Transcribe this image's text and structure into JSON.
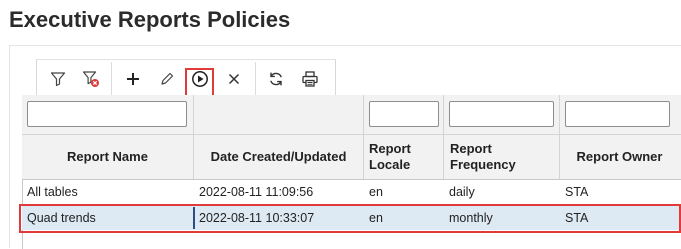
{
  "page": {
    "title": "Executive Reports Policies"
  },
  "toolbar": {
    "buttons": [
      {
        "name": "filter-icon"
      },
      {
        "name": "clear-filter-icon"
      },
      {
        "name": "add-icon"
      },
      {
        "name": "edit-icon"
      },
      {
        "name": "run-icon"
      },
      {
        "name": "delete-icon"
      },
      {
        "name": "refresh-icon"
      },
      {
        "name": "print-icon"
      }
    ]
  },
  "table": {
    "columns": [
      {
        "label": "Report Name"
      },
      {
        "label": "Date Created/Updated"
      },
      {
        "label": "Report\nLocale"
      },
      {
        "label": "Report\nFrequency"
      },
      {
        "label": "Report Owner"
      }
    ],
    "rows": [
      {
        "name": "All tables",
        "date": "2022-08-11 11:09:56",
        "locale": "en",
        "frequency": "daily",
        "owner": "STA",
        "selected": false
      },
      {
        "name": "Quad trends",
        "date": "2022-08-11 10:33:07",
        "locale": "en",
        "frequency": "monthly",
        "owner": "STA",
        "selected": true
      }
    ]
  },
  "colors": {
    "highlight": "#e03a3a",
    "selected_row": "#dde9f3",
    "clear_filter_badge": "#e03a3a"
  }
}
